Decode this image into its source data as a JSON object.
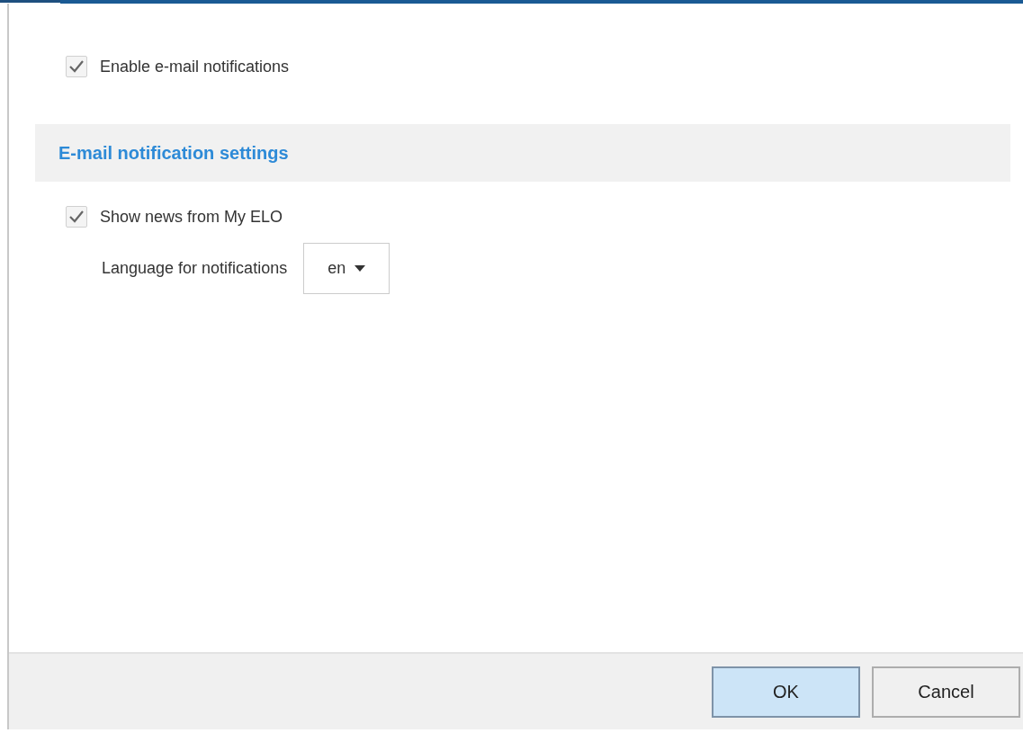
{
  "enable_notifications": {
    "label": "Enable e-mail notifications",
    "checked": true
  },
  "section": {
    "title": "E-mail notification settings",
    "show_news": {
      "label": "Show news from My ELO",
      "checked": true
    },
    "language": {
      "label": "Language for notifications",
      "value": "en"
    }
  },
  "buttons": [
    {
      "label": "OK",
      "default": true
    },
    {
      "label": "Cancel",
      "default": false
    }
  ]
}
